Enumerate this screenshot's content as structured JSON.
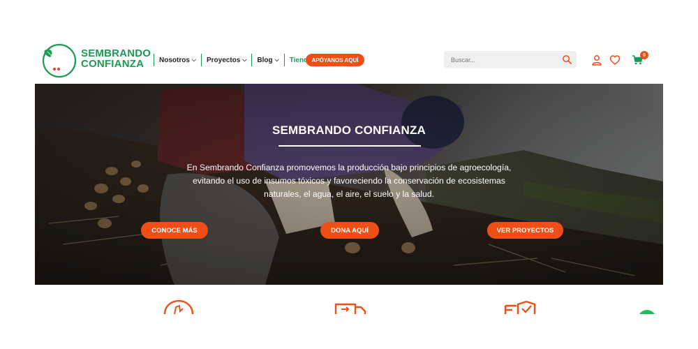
{
  "brand": {
    "name_line1": "SEMBRANDO",
    "name_line2": "CONFIANZA",
    "color_green": "#1a9a54",
    "color_accent": "#f04e17"
  },
  "nav": {
    "items": [
      {
        "label": "Nosotros",
        "has_dropdown": true
      },
      {
        "label": "Proyectos",
        "has_dropdown": true
      },
      {
        "label": "Blog",
        "has_dropdown": true
      },
      {
        "label": "Tienda",
        "has_dropdown": true,
        "active": true
      }
    ],
    "support_button": "APÓYANOS AQUÍ"
  },
  "search": {
    "placeholder": "Buscar...",
    "icon": "search-icon"
  },
  "header_icons": [
    "user-icon",
    "heart-icon",
    "cart-icon"
  ],
  "cart": {
    "count": "0"
  },
  "hero": {
    "title": "SEMBRANDO CONFIANZA",
    "line1": "En Sembrando Confianza promovemos la producción bajo principios de agroecología,",
    "line2": "evitando el uso de insumos tóxicos y favoreciendo la conservación de ecosistemas",
    "line3": "naturales, el agua, el aire, el suelo y la salud.",
    "buttons": [
      "CONOCE MÁS",
      "DONA AQUÍ",
      "VER PROYECTOS"
    ]
  },
  "features": [
    "hand-plant-icon",
    "delivery-truck-icon",
    "shield-check-icon"
  ]
}
